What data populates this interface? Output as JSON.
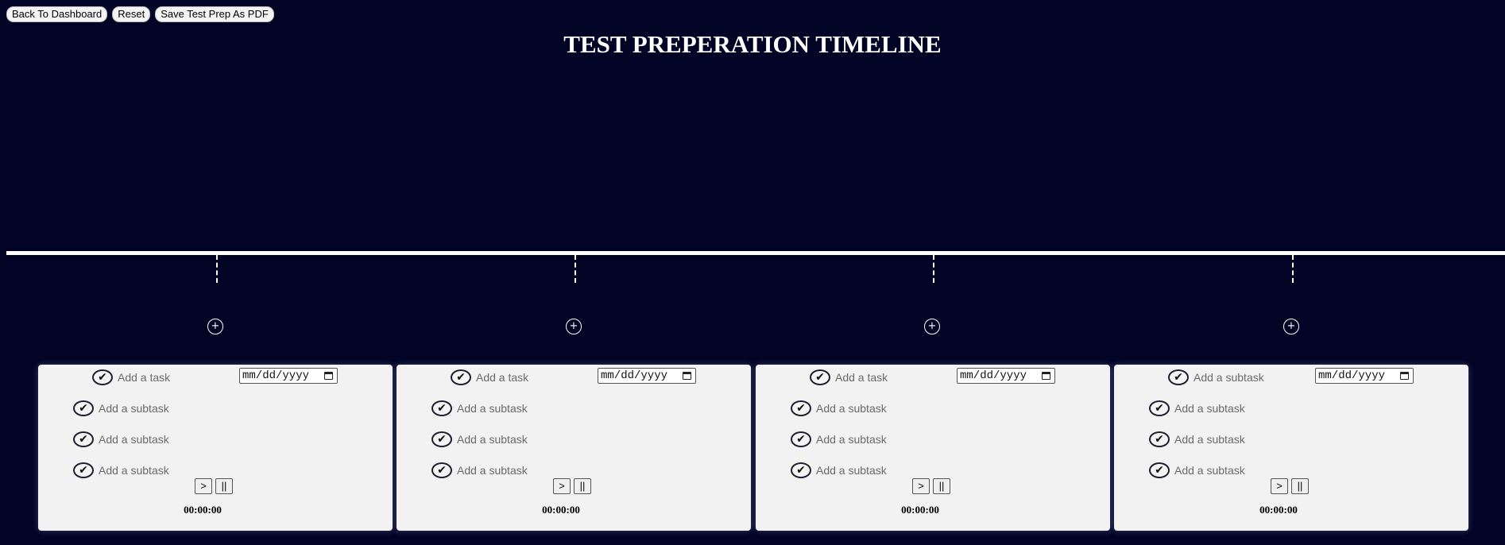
{
  "toolbar": {
    "back_label": "Back To Dashboard",
    "reset_label": "Reset",
    "save_label": "Save Test Prep As PDF"
  },
  "page_title": "TEST PREPERATION TIMELINE",
  "icons": {
    "add": "plus-circle-icon",
    "check": "checkmark-icon",
    "calendar": "calendar-icon"
  },
  "colors": {
    "background": "#020426",
    "timeline": "#ffffff",
    "card": "#f2f2f2"
  },
  "add_symbol": "+",
  "check_symbol": "✔",
  "cards": [
    {
      "header_placeholder": "Add a task",
      "date_placeholder": "mm/dd/yyyy",
      "subtasks": [
        "Add a subtask",
        "Add a subtask",
        "Add a subtask"
      ],
      "play_label": ">",
      "pause_label": "||",
      "timer": "00:00:00"
    },
    {
      "header_placeholder": "Add a task",
      "date_placeholder": "mm/dd/yyyy",
      "subtasks": [
        "Add a subtask",
        "Add a subtask",
        "Add a subtask"
      ],
      "play_label": ">",
      "pause_label": "||",
      "timer": "00:00:00"
    },
    {
      "header_placeholder": "Add a task",
      "date_placeholder": "mm/dd/yyyy",
      "subtasks": [
        "Add a subtask",
        "Add a subtask",
        "Add a subtask"
      ],
      "play_label": ">",
      "pause_label": "||",
      "timer": "00:00:00"
    },
    {
      "header_placeholder": "Add a subtask",
      "date_placeholder": "mm/dd/yyyy",
      "subtasks": [
        "Add a subtask",
        "Add a subtask",
        "Add a subtask"
      ],
      "play_label": ">",
      "pause_label": "||",
      "timer": "00:00:00"
    }
  ]
}
